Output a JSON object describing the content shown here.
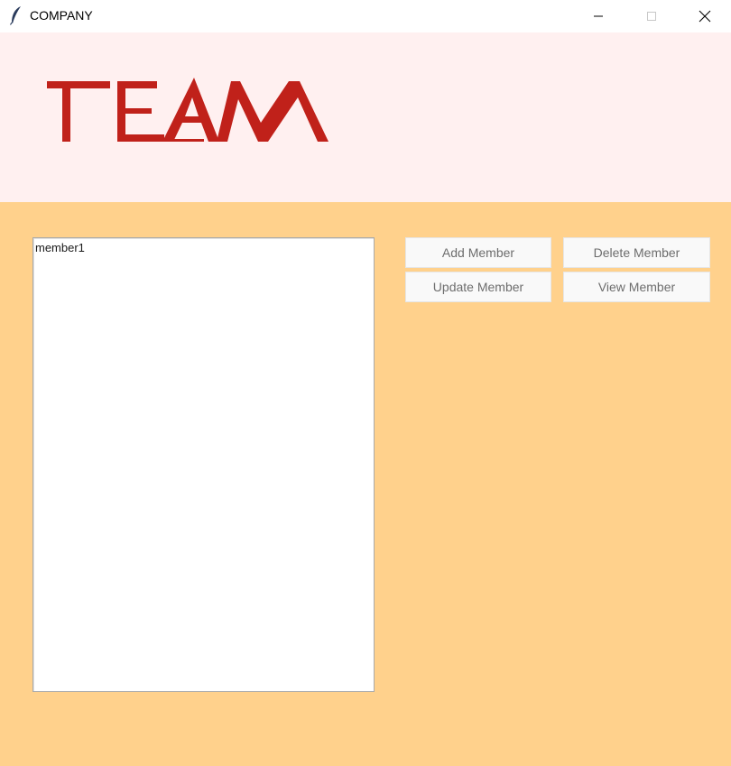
{
  "window": {
    "title": "COMPANY",
    "icon": "feather-icon",
    "controls": [
      "minimize-icon",
      "maximize-icon",
      "close-icon"
    ]
  },
  "header": {
    "logo_text": "TEAM",
    "logo_color": "#c0211a",
    "background": "#fff0f0"
  },
  "main": {
    "background": "#ffd18c",
    "members": [
      "member1"
    ],
    "buttons": {
      "add": "Add Member",
      "delete": "Delete Member",
      "update": "Update Member",
      "view": "View Member"
    }
  }
}
